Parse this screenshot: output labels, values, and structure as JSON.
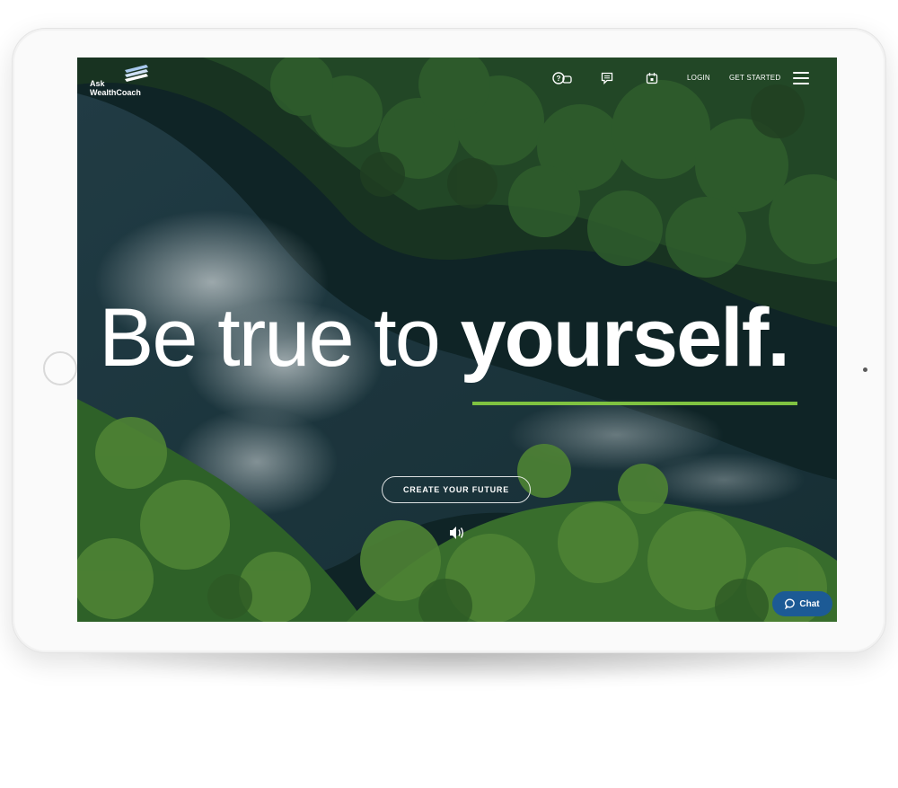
{
  "logo": {
    "line1": "Ask",
    "line2": "WealthCoach"
  },
  "nav": {
    "icons": [
      "chat-question-icon",
      "message-icon",
      "calendar-icon"
    ],
    "login": "LOGIN",
    "get_started": "GET STARTED",
    "menu_icon": "hamburger-menu-icon"
  },
  "hero": {
    "headline_light": "Be true to ",
    "headline_bold": "yourself.",
    "cta_label": "CREATE YOUR FUTURE",
    "sound_icon": "speaker-icon"
  },
  "chat": {
    "label": "Chat",
    "icon": "chat-bubble-icon"
  },
  "colors": {
    "accent": "#7fc241",
    "chat_button": "#1c5a95"
  }
}
